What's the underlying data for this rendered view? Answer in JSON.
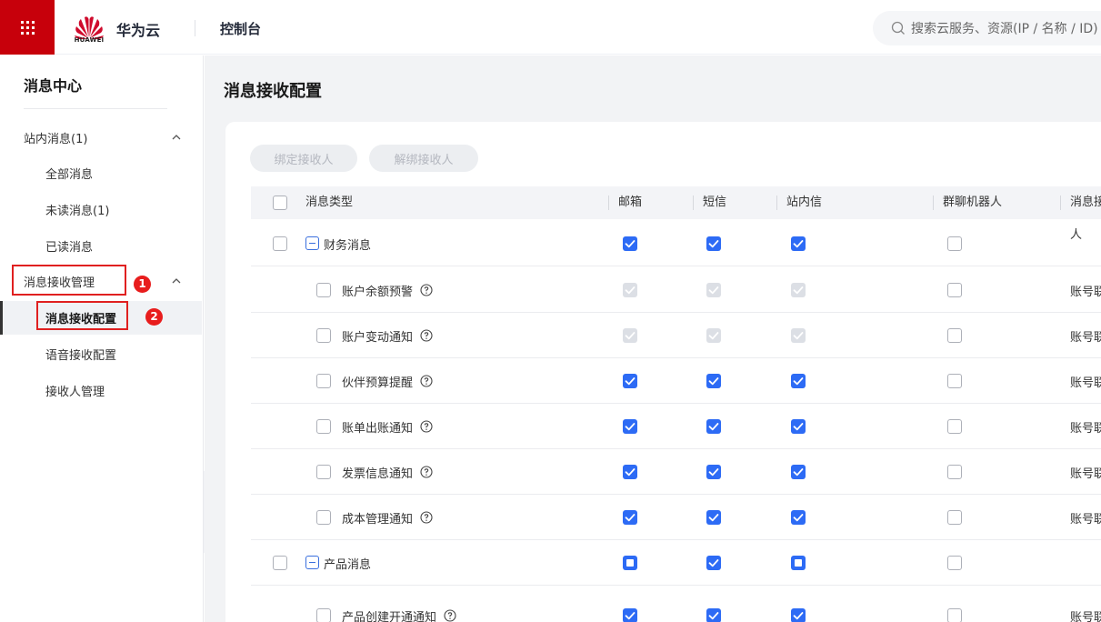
{
  "header": {
    "logo_word": "HUAWEI",
    "brand": "华为云",
    "console": "控制台",
    "search_placeholder": "搜索云服务、资源(IP / 名称 / ID)"
  },
  "sidebar": {
    "title": "消息中心",
    "group1": {
      "label": "站内消息(1)",
      "items": [
        "全部消息",
        "未读消息(1)",
        "已读消息"
      ]
    },
    "group2": {
      "label": "消息接收管理",
      "items": [
        "消息接收配置",
        "语音接收配置",
        "接收人管理"
      ]
    },
    "badges": [
      "1",
      "2"
    ]
  },
  "main": {
    "page_title": "消息接收配置",
    "buttons": {
      "bind": "绑定接收人",
      "unbind": "解绑接收人"
    },
    "columns": [
      "消息类型",
      "邮箱",
      "短信",
      "站内信",
      "群聊机器人",
      "消息接收人"
    ],
    "rows": [
      {
        "name": "财务消息",
        "group": true,
        "email": "checked",
        "sms": "checked",
        "inbox": "checked",
        "bot": "empty",
        "receiver": ""
      },
      {
        "name": "账户余额预警",
        "email": "disabled",
        "sms": "disabled",
        "inbox": "disabled",
        "bot": "empty",
        "receiver": "账号联系人"
      },
      {
        "name": "账户变动通知",
        "email": "disabled",
        "sms": "disabled",
        "inbox": "disabled",
        "bot": "empty",
        "receiver": "账号联系人"
      },
      {
        "name": "伙伴预算提醒",
        "email": "checked",
        "sms": "checked",
        "inbox": "checked",
        "bot": "empty",
        "receiver": "账号联系人"
      },
      {
        "name": "账单出账通知",
        "email": "checked",
        "sms": "checked",
        "inbox": "checked",
        "bot": "empty",
        "receiver": "账号联系人"
      },
      {
        "name": "发票信息通知",
        "email": "checked",
        "sms": "checked",
        "inbox": "checked",
        "bot": "empty",
        "receiver": "账号联系人"
      },
      {
        "name": "成本管理通知",
        "email": "checked",
        "sms": "checked",
        "inbox": "checked",
        "bot": "empty",
        "receiver": "账号联系人"
      },
      {
        "name": "产品消息",
        "group": true,
        "email": "indeterminate",
        "sms": "checked",
        "inbox": "indeterminate",
        "bot": "empty",
        "receiver": ""
      },
      {
        "name": "产品创建开通通知",
        "email": "checked",
        "sms": "checked",
        "inbox": "checked",
        "bot": "empty",
        "receiver": "账号联系人"
      }
    ]
  },
  "colors": {
    "brand_red": "#c7000b",
    "checkbox_blue": "#2d6bf5",
    "annotation_red": "#e02020"
  },
  "icons": [
    "grid-menu-icon",
    "huawei-logo",
    "search-icon",
    "chevron-up-icon",
    "chevron-left-icon",
    "collapse-minus-icon",
    "help-circle-icon",
    "checkmark-icon"
  ]
}
